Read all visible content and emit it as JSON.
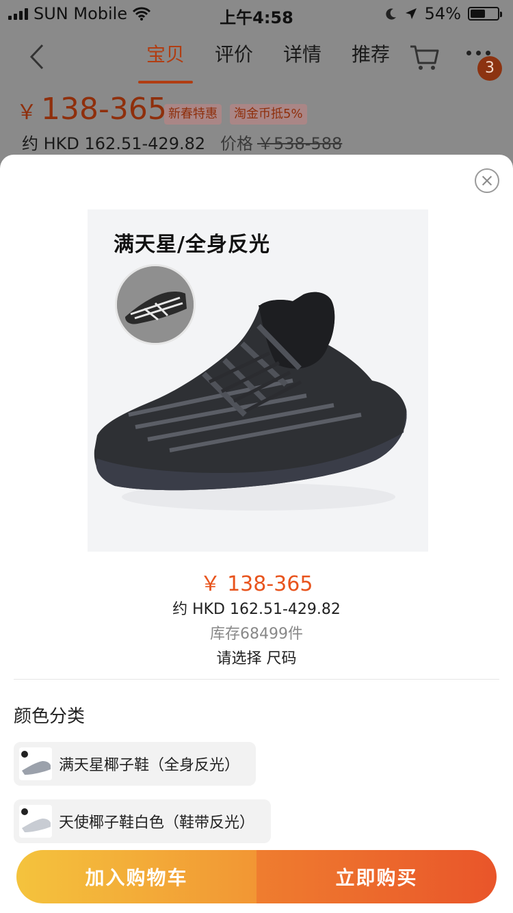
{
  "status_bar": {
    "carrier": "SUN Mobile",
    "time": "上午4:58",
    "battery": "54%",
    "battery_level": 0.54
  },
  "nav": {
    "tabs": [
      {
        "label": "宝贝",
        "active": true
      },
      {
        "label": "评价",
        "active": false
      },
      {
        "label": "详情",
        "active": false
      },
      {
        "label": "推荐",
        "active": false
      }
    ],
    "badge_count": "3",
    "icons": [
      "back-icon",
      "cart-icon",
      "more-icon"
    ]
  },
  "background_price": {
    "currency": "￥",
    "range": "138-365",
    "tags": [
      "新春特惠",
      "淘金币抵5%"
    ],
    "hkd": "约 HKD 162.51-429.82",
    "orig_label": "价格",
    "orig_price": "￥538-588"
  },
  "sheet": {
    "image_caption": "满天星/全身反光",
    "price": "￥ 138-365",
    "hkd": "约 HKD 162.51-429.82",
    "stock": "库存68499件",
    "select_hint": "请选择 尺码",
    "section_title": "颜色分类",
    "options": [
      {
        "label": "满天星椰子鞋（全身反光）"
      },
      {
        "label": "天使椰子鞋白色（鞋带反光）"
      }
    ]
  },
  "actions": {
    "add_to_cart": "加入购物车",
    "buy_now": "立即购买"
  },
  "colors": {
    "accent": "#e8541d",
    "cta_left": "#f4c33d",
    "cta_right": "#e9552a"
  }
}
